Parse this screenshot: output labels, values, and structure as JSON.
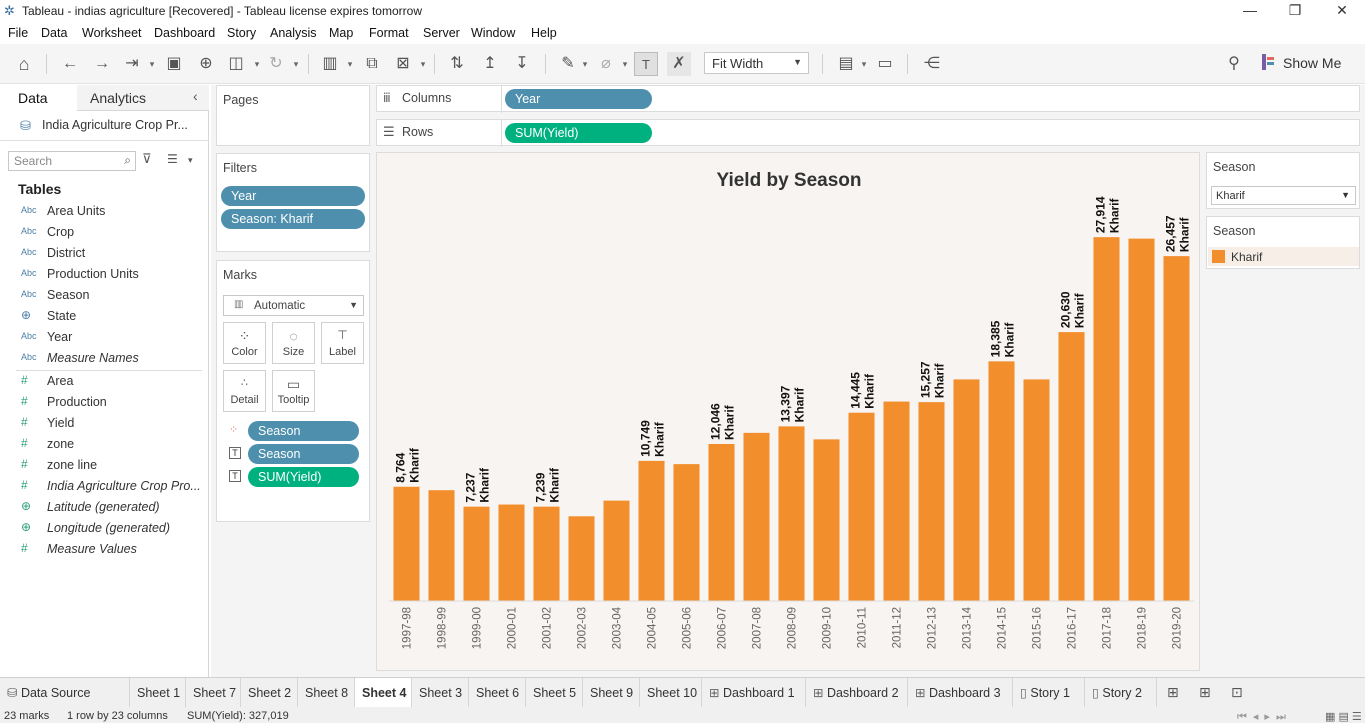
{
  "window": {
    "title": "Tableau - indias agriculture [Recovered] - Tableau license expires tomorrow",
    "minimize": "—",
    "restore": "❐",
    "close": "✕"
  },
  "menu": [
    "File",
    "Data",
    "Worksheet",
    "Dashboard",
    "Story",
    "Analysis",
    "Map",
    "Format",
    "Server",
    "Window",
    "Help"
  ],
  "toolbar": {
    "fit_label": "Fit Width",
    "show_me": "Show Me"
  },
  "data_pane": {
    "tab_data": "Data",
    "tab_analytics": "Analytics",
    "source": "India Agriculture Crop Pr...",
    "search_placeholder": "Search",
    "tables_label": "Tables",
    "dimensions": [
      {
        "type": "Abc",
        "name": "Area Units"
      },
      {
        "type": "Abc",
        "name": "Crop"
      },
      {
        "type": "Abc",
        "name": "District"
      },
      {
        "type": "Abc",
        "name": "Production Units"
      },
      {
        "type": "Abc",
        "name": "Season"
      },
      {
        "type": "geo",
        "name": "State"
      },
      {
        "type": "Abc",
        "name": "Year"
      },
      {
        "type": "Abc",
        "name": "Measure Names",
        "italic": true
      }
    ],
    "measures": [
      {
        "type": "#",
        "name": "Area"
      },
      {
        "type": "#",
        "name": "Production"
      },
      {
        "type": "#",
        "name": "Yield"
      },
      {
        "type": "#",
        "name": "zone"
      },
      {
        "type": "#",
        "name": "zone line"
      },
      {
        "type": "#",
        "name": "India Agriculture Crop Pro...",
        "italic": true
      },
      {
        "type": "geo",
        "name": "Latitude (generated)",
        "italic": true
      },
      {
        "type": "geo",
        "name": "Longitude (generated)",
        "italic": true
      },
      {
        "type": "#",
        "name": "Measure Values",
        "italic": true
      }
    ]
  },
  "pages": {
    "title": "Pages"
  },
  "filters": {
    "title": "Filters",
    "items": [
      "Year",
      "Season: Kharif"
    ]
  },
  "marks": {
    "title": "Marks",
    "type": "Automatic",
    "buttons": [
      "Color",
      "Size",
      "Label",
      "Detail",
      "Tooltip"
    ],
    "pills": [
      {
        "icon": "color",
        "label": "Season",
        "color": "#4e8fad"
      },
      {
        "icon": "label",
        "label": "Season",
        "color": "#4e8fad"
      },
      {
        "icon": "label",
        "label": "SUM(Yield)",
        "color": "#00b180"
      }
    ]
  },
  "shelves": {
    "columns_label": "Columns",
    "columns_pill": "Year",
    "rows_label": "Rows",
    "rows_pill": "SUM(Yield)"
  },
  "filter_card": {
    "title": "Season",
    "value": "Kharif"
  },
  "legend": {
    "title": "Season",
    "item": "Kharif",
    "color": "#f28e2b"
  },
  "chart_data": {
    "type": "bar",
    "title": "Yield by Season",
    "categories": [
      "1997-98",
      "1998-99",
      "1999-00",
      "2000-01",
      "2001-02",
      "2002-03",
      "2003-04",
      "2004-05",
      "2005-06",
      "2006-07",
      "2007-08",
      "2008-09",
      "2009-10",
      "2010-11",
      "2011-12",
      "2012-13",
      "2013-14",
      "2014-15",
      "2015-16",
      "2016-17",
      "2017-18",
      "2018-19",
      "2019-20"
    ],
    "values": [
      8764,
      8500,
      7237,
      7400,
      7239,
      6500,
      7700,
      10749,
      10500,
      12046,
      12900,
      13397,
      12400,
      14445,
      15300,
      15257,
      17000,
      18385,
      17000,
      20630,
      27914,
      27800,
      26457
    ],
    "labels": [
      "8,764",
      "",
      "7,237",
      "",
      "7,239",
      "",
      "",
      "10,749",
      "",
      "12,046",
      "",
      "13,397",
      "",
      "14,445",
      "",
      "15,257",
      "",
      "18,385",
      "",
      "20,630",
      "27,914",
      "",
      "26,457"
    ],
    "label_season": "Kharif",
    "color": "#f28e2b",
    "ylim": [
      0,
      29000
    ]
  },
  "sheet_tabs": [
    "Data Source",
    "Sheet 1",
    "Sheet 7",
    "Sheet 2",
    "Sheet 8",
    "Sheet 4",
    "Sheet 3",
    "Sheet 6",
    "Sheet 5",
    "Sheet 9",
    "Sheet 10",
    "Dashboard 1",
    "Dashboard 2",
    "Dashboard 3",
    "Story 1",
    "Story 2"
  ],
  "active_tab": "Sheet 4",
  "status": {
    "marks": "23 marks",
    "rows": "1 row by 23 columns",
    "sum": "SUM(Yield): 327,019"
  }
}
